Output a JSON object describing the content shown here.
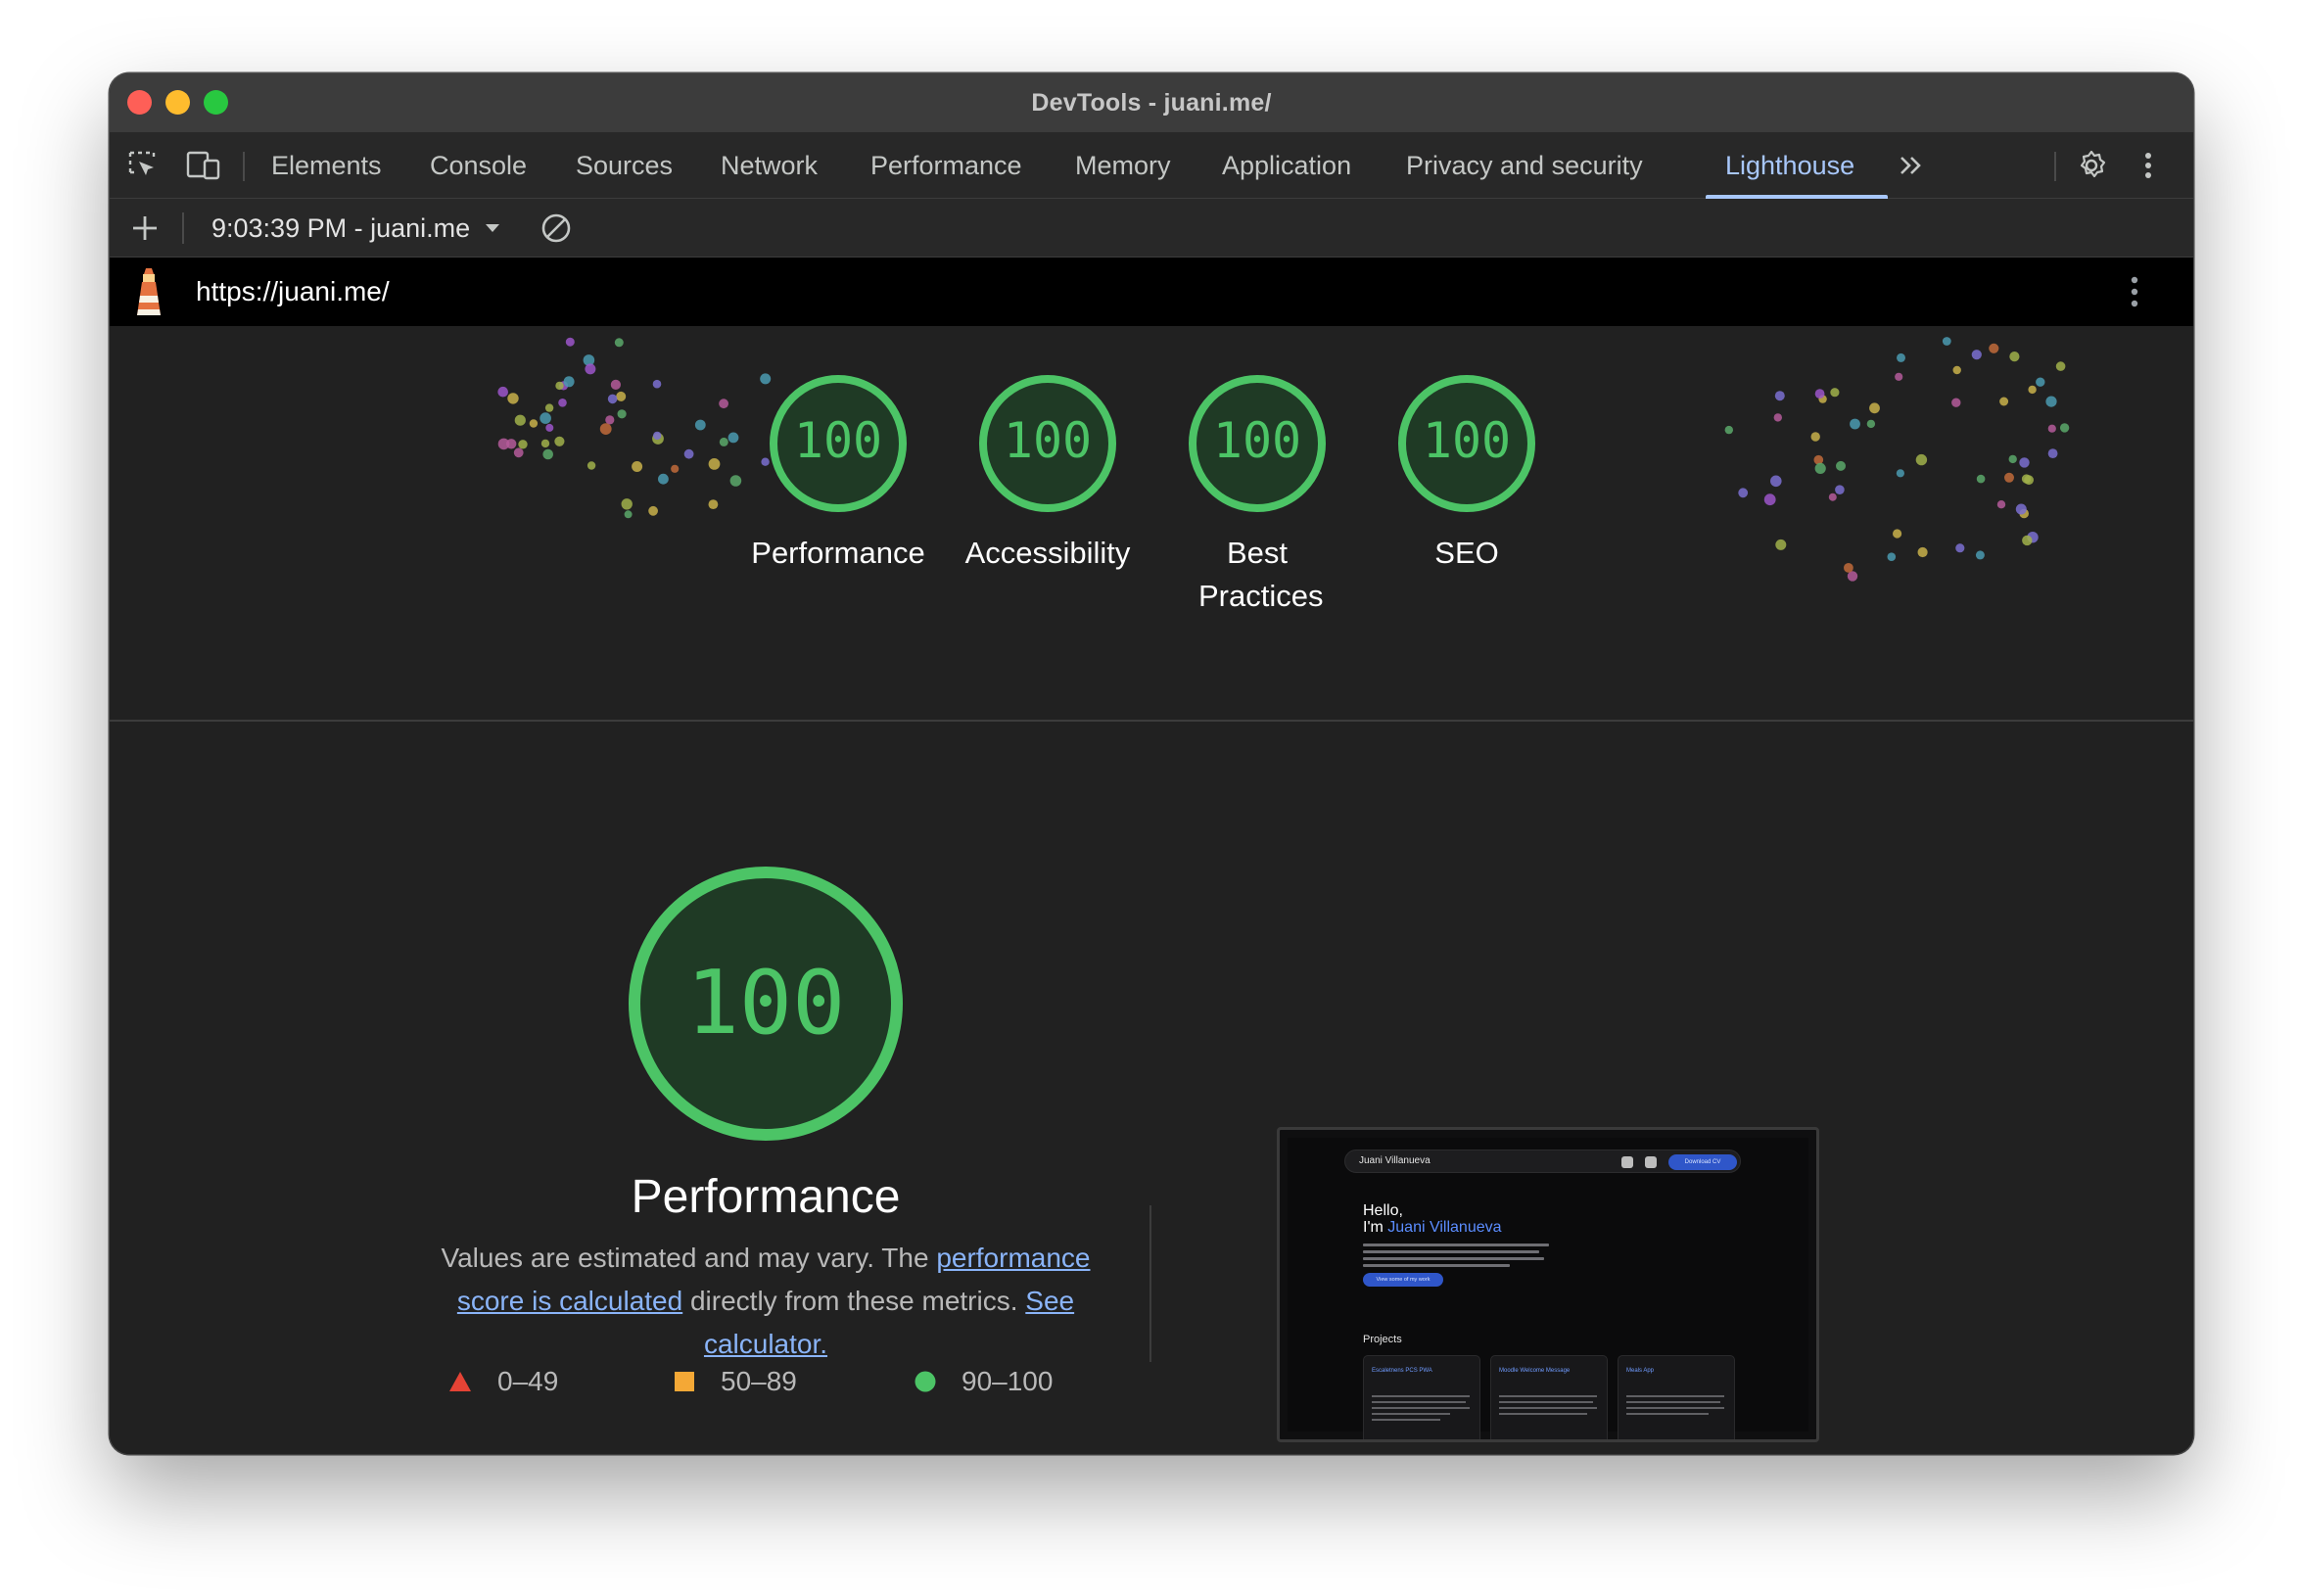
{
  "window": {
    "title": "DevTools - juani.me/"
  },
  "tabs": [
    {
      "label": "Elements"
    },
    {
      "label": "Console"
    },
    {
      "label": "Sources"
    },
    {
      "label": "Network"
    },
    {
      "label": "Performance"
    },
    {
      "label": "Memory"
    },
    {
      "label": "Application"
    },
    {
      "label": "Privacy and security"
    },
    {
      "label": "Lighthouse",
      "active": true
    }
  ],
  "toolbar": {
    "report": "9:03:39 PM - juani.me"
  },
  "url": "https://juani.me/",
  "scores": [
    {
      "label": "Performance",
      "score": "100"
    },
    {
      "label": "Accessibility",
      "score": "100"
    },
    {
      "label": "Best Practices",
      "score": "100"
    },
    {
      "label": "SEO",
      "score": "100"
    }
  ],
  "main_gauge": {
    "score": "100",
    "label": "Performance"
  },
  "description": {
    "prefix": "Values are estimated and may vary. The ",
    "link1": "performance score is calculated",
    "middle": " directly from these metrics. ",
    "link2": "See calculator."
  },
  "legend": [
    {
      "range": "0–49",
      "color": "#e54335"
    },
    {
      "range": "50–89",
      "color": "#f4a836"
    },
    {
      "range": "90–100",
      "color": "#4cc466"
    }
  ],
  "colors": {
    "pass": "#4cc466",
    "pass_fill": "#1f3a25",
    "accent": "#a8c7fa"
  },
  "thumbnail": {
    "nav_name": "Juani Villanueva",
    "nav_button": "Download CV",
    "greeting": "Hello,",
    "im": "I'm ",
    "name": "Juani Villanueva",
    "cta": "View some of my work",
    "projects": "Projects",
    "cards": [
      "Escaletnens PCS PWA",
      "Moodle Welcome Message",
      "Meals App"
    ]
  }
}
